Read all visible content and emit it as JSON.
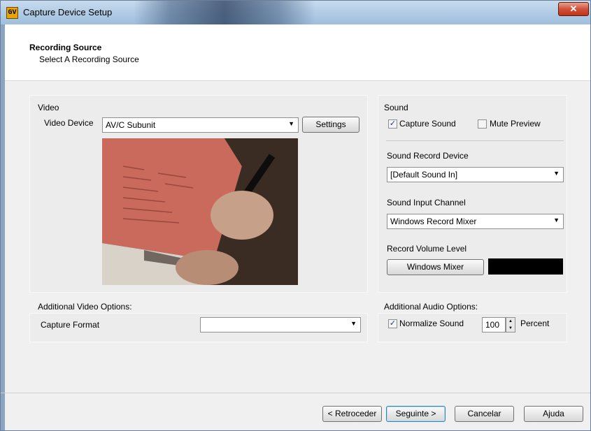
{
  "window": {
    "title": "Capture Device Setup",
    "icon_text": "GV",
    "close_symbol": "✕"
  },
  "header": {
    "title": "Recording Source",
    "subtitle": "Select A Recording Source"
  },
  "video": {
    "group_label": "Video",
    "device_label": "Video Device",
    "device_value": "AV/C Subunit",
    "settings_button": "Settings"
  },
  "sound": {
    "group_label": "Sound",
    "capture_sound_label": "Capture Sound",
    "capture_sound_checked": true,
    "mute_preview_label": "Mute Preview",
    "mute_preview_checked": false,
    "record_device_label": "Sound Record Device",
    "record_device_value": "[Default Sound In]",
    "input_channel_label": "Sound Input Channel",
    "input_channel_value": "Windows Record Mixer",
    "volume_label": "Record Volume Level",
    "mixer_button": "Windows Mixer"
  },
  "additional_video": {
    "group_label": "Additional Video Options:",
    "capture_format_label": "Capture Format",
    "capture_format_value": ""
  },
  "additional_audio": {
    "group_label": "Additional Audio Options:",
    "normalize_label": "Normalize Sound",
    "normalize_checked": true,
    "percent_value": "100",
    "percent_label": "Percent"
  },
  "footer": {
    "back_button": "< Retroceder",
    "next_button": "Seguinte >",
    "cancel_button": "Cancelar",
    "help_button": "Ajuda"
  },
  "icons": {
    "dropdown_arrow": "▼",
    "check_mark": "✓",
    "spin_up": "▲",
    "spin_down": "▼"
  }
}
